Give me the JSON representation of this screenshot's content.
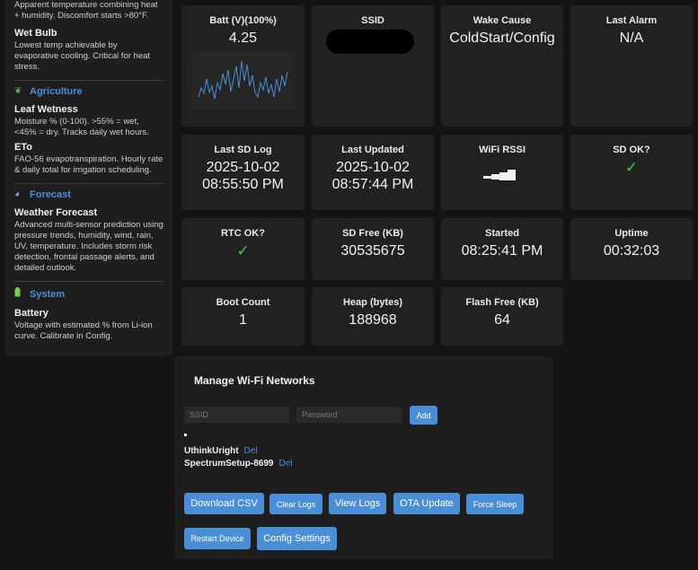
{
  "sidebar": {
    "intro_desc": "Apparent temperature combining heat + humidity. Discomfort starts >80°F.",
    "wet_bulb": {
      "title": "Wet Bulb",
      "desc": "Lowest temp achievable by evaporative cooling. Critical for heat stress."
    },
    "agriculture": {
      "heading": "Agriculture",
      "icon": "leaf-icon",
      "items": [
        {
          "title": "Leaf Wetness",
          "desc": "Moisture % (0-100). >55% = wet, <45% = dry. Tracks daily wet hours."
        },
        {
          "title": "ETo",
          "desc": "FAO-56 evapotranspiration. Hourly rate & daily total for irrigation scheduling."
        }
      ]
    },
    "forecast": {
      "heading": "Forecast",
      "icon": "crystal-ball-icon",
      "items": [
        {
          "title": "Weather Forecast",
          "desc": "Advanced multi-sensor prediction using pressure trends, humidity, wind, rain, UV, temperature. Includes storm risk detection, frontal passage alerts, and detailed outlook."
        }
      ]
    },
    "system": {
      "heading": "System",
      "icon": "battery-icon",
      "items": [
        {
          "title": "Battery",
          "desc": "Voltage with estimated % from Li-ion curve. Calibrate in Config."
        }
      ]
    }
  },
  "tiles": {
    "batt": {
      "label": "Batt (V)(100%)",
      "value": "4.25"
    },
    "ssid": {
      "label": "SSID"
    },
    "wake": {
      "label": "Wake Cause",
      "value": "ColdStart/Config"
    },
    "alarm": {
      "label": "Last Alarm",
      "value": "N/A"
    },
    "sdlog": {
      "label": "Last SD Log",
      "date": "2025-10-02",
      "time": "08:55:50 PM"
    },
    "updated": {
      "label": "Last Updated",
      "date": "2025-10-02",
      "time": "08:57:44 PM"
    },
    "rssi": {
      "label": "WiFi RSSI"
    },
    "sdok": {
      "label": "SD OK?",
      "value": "✓"
    },
    "rtcok": {
      "label": "RTC OK?",
      "value": "✓"
    },
    "sdfree": {
      "label": "SD Free (KB)",
      "value": "30535675"
    },
    "started": {
      "label": "Started",
      "value": "08:25:41 PM"
    },
    "uptime": {
      "label": "Uptime",
      "value": "00:32:03"
    },
    "boot": {
      "label": "Boot Count",
      "value": "1"
    },
    "heap": {
      "label": "Heap (bytes)",
      "value": "188968"
    },
    "flash": {
      "label": "Flash Free (KB)",
      "value": "64"
    }
  },
  "wifi": {
    "title": "Manage Wi-Fi Networks",
    "ssid_placeholder": "SSID",
    "password_placeholder": "Password",
    "add_label": "Add",
    "networks": [
      {
        "ssid": "UthinkUright",
        "del": "Del"
      },
      {
        "ssid": "SpectrumSetup-8699",
        "del": "Del"
      }
    ],
    "buttons": {
      "download_csv": "Download CSV",
      "clear_logs": "Clear Logs",
      "view_logs": "View Logs",
      "ota_update": "OTA Update",
      "force_sleep": "Force Sleep",
      "restart_device": "Restart Device",
      "config_settings": "Config Settings"
    }
  },
  "colors": {
    "accent": "#4a8fd6",
    "ok": "#3ad43a",
    "tile_bg": "#212121",
    "page_bg": "#141414"
  }
}
